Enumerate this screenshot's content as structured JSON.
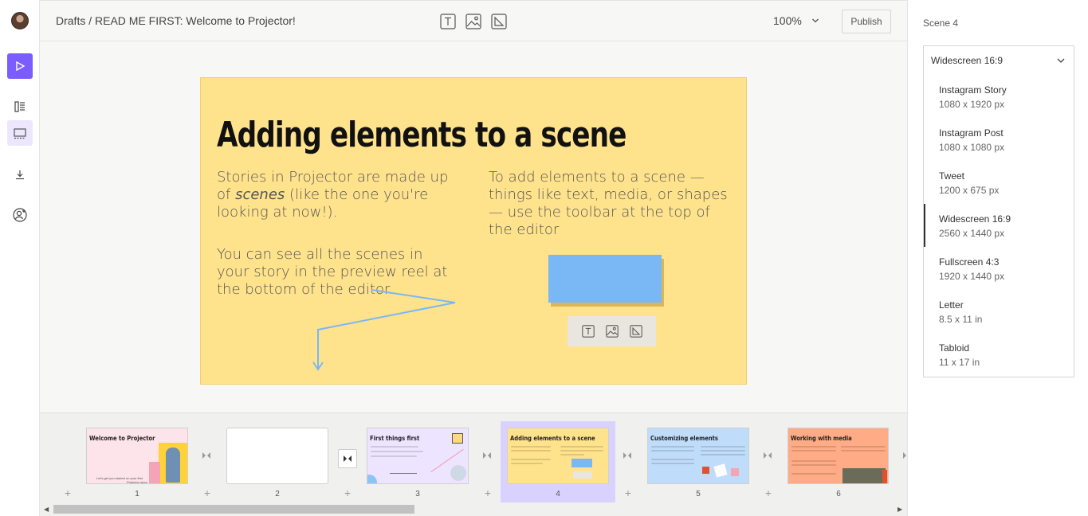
{
  "header": {
    "breadcrumb": "Drafts / READ ME FIRST: Welcome to Projector!",
    "zoom": "100%",
    "publish_label": "Publish",
    "toolbar_icons": [
      "text-tool-icon",
      "image-tool-icon",
      "shape-tool-icon"
    ]
  },
  "sidebar": {
    "items": [
      "play-icon",
      "stories-icon",
      "scene-icon",
      "download-icon",
      "add-user-icon"
    ],
    "accent": "#7b5cff"
  },
  "scene": {
    "title": "Adding elements to a scene",
    "p1_a": "Stories in Projector are made up of ",
    "p1_em": "scenes",
    "p1_b": " (like the one you're looking at now!).",
    "p2": "You can see all the scenes in your story in the preview reel at the bottom of the editor.",
    "p3": "To add elements to a scene — things like text, media, or shapes — use the toolbar at the top of the editor",
    "bg_color": "#ffe38c"
  },
  "right_panel": {
    "title": "Scene 4",
    "selected": "Widescreen 16:9",
    "options": [
      {
        "name": "Instagram Story",
        "size": "1080 x 1920 px"
      },
      {
        "name": "Instagram Post",
        "size": "1080 x 1080 px"
      },
      {
        "name": "Tweet",
        "size": "1200 x 675 px"
      },
      {
        "name": "Widescreen 16:9",
        "size": "2560 x 1440 px"
      },
      {
        "name": "Fullscreen 4:3",
        "size": "1920 x 1440 px"
      },
      {
        "name": "Letter",
        "size": "8.5 x 11 in"
      },
      {
        "name": "Tabloid",
        "size": "11 x 17 in"
      }
    ]
  },
  "reel": {
    "thumbs": [
      {
        "number": "1",
        "title": "Welcome to Projector",
        "color": "#fde3ea"
      },
      {
        "number": "2",
        "title": "",
        "color": "#ffffff"
      },
      {
        "number": "3",
        "title": "First things first",
        "color": "#ede5ff"
      },
      {
        "number": "4",
        "title": "Adding elements to a scene",
        "color": "#ffe38c"
      },
      {
        "number": "5",
        "title": "Customizing elements",
        "color": "#bfdcfb"
      },
      {
        "number": "6",
        "title": "Working with media",
        "color": "#ffab85"
      }
    ],
    "thumb1_text_a": "Let's get you started on your first",
    "thumb1_text_b": "Projector story",
    "add_symbol": "+"
  }
}
